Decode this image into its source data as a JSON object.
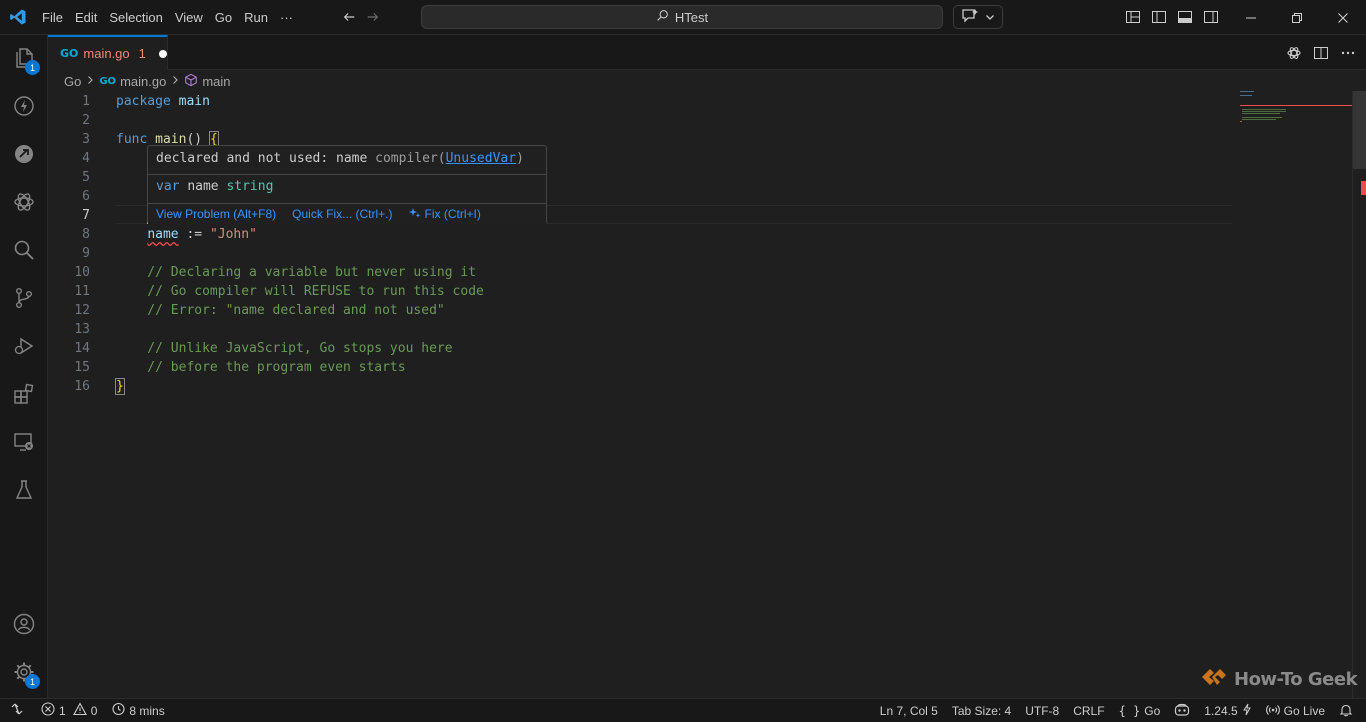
{
  "titlebar": {
    "menu": [
      "File",
      "Edit",
      "Selection",
      "View",
      "Go",
      "Run",
      "···"
    ],
    "search_text": "HTest"
  },
  "activity": {
    "explorer_badge": "1",
    "settings_badge": "1"
  },
  "tab": {
    "icon": "GO",
    "name": "main.go",
    "problems": "1"
  },
  "breadcrumb": {
    "items": [
      "Go",
      "main.go",
      "main"
    ]
  },
  "editor": {
    "active_line": 7,
    "lines": [
      {
        "n": "1",
        "tokens": [
          {
            "t": "package",
            "c": "kw"
          },
          {
            "t": " ",
            "c": "plain"
          },
          {
            "t": "main",
            "c": "var"
          }
        ]
      },
      {
        "n": "2",
        "tokens": []
      },
      {
        "n": "3",
        "tokens": [
          {
            "t": "func",
            "c": "kw"
          },
          {
            "t": " ",
            "c": "plain"
          },
          {
            "t": "main",
            "c": "fn"
          },
          {
            "t": "() ",
            "c": "plain"
          },
          {
            "t": "{",
            "c": "brace"
          }
        ]
      },
      {
        "n": "4",
        "tokens": []
      },
      {
        "n": "5",
        "tokens": []
      },
      {
        "n": "6",
        "tokens": []
      },
      {
        "n": "7",
        "tokens": []
      },
      {
        "n": "8",
        "tokens": [
          {
            "t": "    ",
            "c": "plain"
          },
          {
            "t": "name",
            "c": "var err"
          },
          {
            "t": " := ",
            "c": "plain"
          },
          {
            "t": "\"John\"",
            "c": "str"
          }
        ]
      },
      {
        "n": "9",
        "tokens": []
      },
      {
        "n": "10",
        "tokens": [
          {
            "t": "    // Declaring a variable but never using it",
            "c": "cm"
          }
        ]
      },
      {
        "n": "11",
        "tokens": [
          {
            "t": "    // Go compiler will REFUSE to run this code",
            "c": "cm"
          }
        ]
      },
      {
        "n": "12",
        "tokens": [
          {
            "t": "    // Error: \"name declared and not used\"",
            "c": "cm"
          }
        ]
      },
      {
        "n": "13",
        "tokens": []
      },
      {
        "n": "14",
        "tokens": [
          {
            "t": "    // Unlike JavaScript, Go stops you here",
            "c": "cm"
          }
        ]
      },
      {
        "n": "15",
        "tokens": [
          {
            "t": "    // before the program even starts",
            "c": "cm"
          }
        ]
      },
      {
        "n": "16",
        "tokens": [
          {
            "t": "}",
            "c": "brace"
          }
        ]
      }
    ]
  },
  "hover": {
    "message": "declared and not used: name",
    "source": "compiler",
    "code": "UnusedVar",
    "sig_kw": "var",
    "sig_name": "name",
    "sig_type": "string",
    "actions": [
      "View Problem (Alt+F8)",
      "Quick Fix... (Ctrl+.)",
      "Fix (Ctrl+I)"
    ]
  },
  "watermark": "How-To Geek",
  "statusbar": {
    "errors": "1",
    "warnings": "0",
    "time": "8 mins",
    "position": "Ln 7, Col 5",
    "tab_size": "Tab Size: 4",
    "encoding": "UTF-8",
    "eol": "CRLF",
    "language": "Go",
    "go_version": "1.24.5",
    "go_live": "Go Live"
  },
  "colors": {
    "accent": "#0078d4",
    "error": "#f14c4c",
    "link": "#3794ff"
  }
}
